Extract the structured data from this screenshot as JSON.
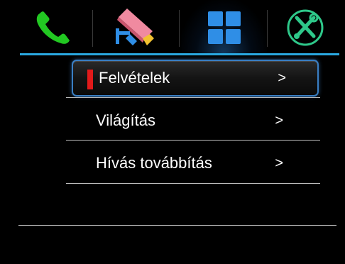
{
  "tabs": [
    {
      "icon": "phone-icon",
      "color": "#22c822"
    },
    {
      "icon": "camera-icon",
      "color": "#f08aa0"
    },
    {
      "icon": "apps-grid-icon",
      "color": "#2f8ee6",
      "active": true
    },
    {
      "icon": "tools-icon",
      "color": "#2ec88a"
    }
  ],
  "accent_color": "#2aa8e0",
  "selection_color": "#e21a1a",
  "menu": {
    "items": [
      {
        "label": "Felvételek",
        "arrow": ">",
        "selected": true
      },
      {
        "label": "Világítás",
        "arrow": ">"
      },
      {
        "label": "Hívás továbbítás",
        "arrow": ">"
      }
    ]
  }
}
